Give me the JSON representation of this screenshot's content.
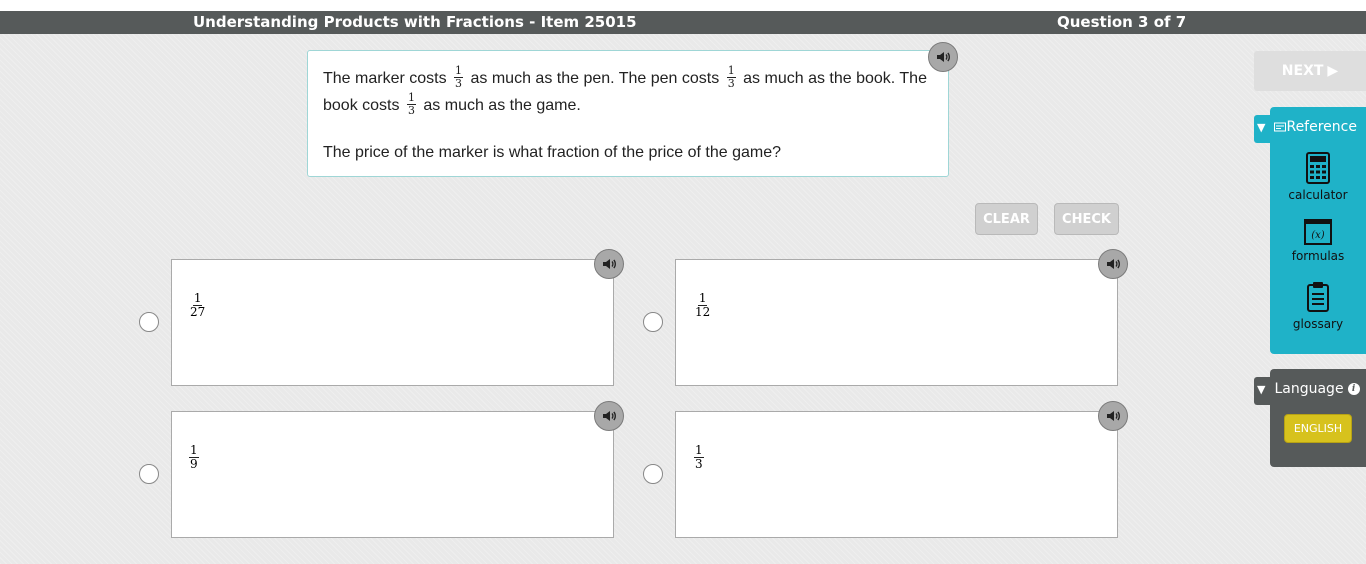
{
  "header": {
    "title": "Understanding Products with Fractions - Item 25015",
    "question_count": "Question 3 of 7"
  },
  "question": {
    "seg1": "The marker costs",
    "seg2": "as much as the pen. The pen costs",
    "seg3": "as much as the book. The",
    "seg4": "book costs",
    "seg5": "as much as the game.",
    "frac1": {
      "num": "1",
      "den": "3"
    },
    "frac2": {
      "num": "1",
      "den": "3"
    },
    "frac3": {
      "num": "1",
      "den": "3"
    },
    "ask": "The price of the marker is what fraction of the price of the game?"
  },
  "buttons": {
    "clear": "CLEAR",
    "check": "CHECK",
    "next": "NEXT"
  },
  "choices": [
    {
      "num": "1",
      "den": "27"
    },
    {
      "num": "1",
      "den": "12"
    },
    {
      "num": "1",
      "den": "9"
    },
    {
      "num": "1",
      "den": "3"
    }
  ],
  "reference": {
    "title": "Reference",
    "tools": [
      {
        "label": "calculator",
        "icon": "calculator-icon"
      },
      {
        "label": "formulas",
        "icon": "formulas-icon",
        "glyph": "(x)"
      },
      {
        "label": "glossary",
        "icon": "glossary-icon"
      }
    ]
  },
  "language": {
    "title": "Language",
    "info_glyph": "i",
    "selected": "ENGLISH"
  },
  "colors": {
    "header_bg": "#565a5a",
    "accent_teal": "#1fb2c8",
    "english_yellow": "#d7c21d"
  }
}
